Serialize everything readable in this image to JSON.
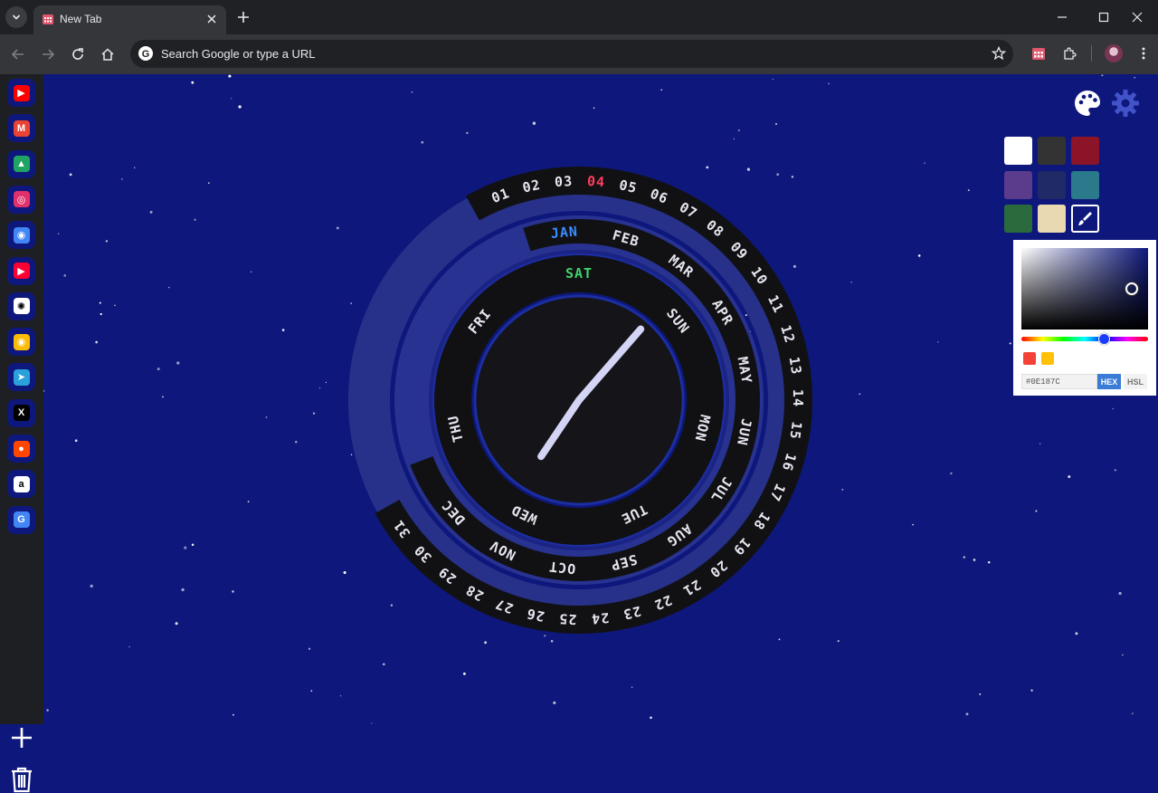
{
  "browser": {
    "tab_title": "New Tab",
    "omnibox_placeholder": "Search Google or type a URL"
  },
  "sidebar": {
    "items": [
      {
        "name": "youtube",
        "color": "#ff0000",
        "glyph": "▶"
      },
      {
        "name": "gmail",
        "color": "#ea4335",
        "glyph": "M"
      },
      {
        "name": "google-drive",
        "color": "#1fa463",
        "glyph": "▲"
      },
      {
        "name": "instagram",
        "color": "#e1306c",
        "glyph": "◎"
      },
      {
        "name": "chromium",
        "color": "#4285f4",
        "glyph": "◉"
      },
      {
        "name": "youtube-music",
        "color": "#ff0033",
        "glyph": "▶"
      },
      {
        "name": "chatgpt",
        "color": "#ffffff",
        "glyph": "✺"
      },
      {
        "name": "chrome",
        "color": "#fbbc05",
        "glyph": "◉"
      },
      {
        "name": "telegram",
        "color": "#2aa1da",
        "glyph": "➤"
      },
      {
        "name": "x",
        "color": "#000000",
        "glyph": "X"
      },
      {
        "name": "reddit",
        "color": "#ff4500",
        "glyph": "●"
      },
      {
        "name": "amazon",
        "color": "#ffffff",
        "glyph": "a"
      },
      {
        "name": "google-translate",
        "color": "#4285f4",
        "glyph": "G"
      }
    ]
  },
  "clock": {
    "days_of_month": [
      "01",
      "02",
      "03",
      "04",
      "05",
      "06",
      "07",
      "08",
      "09",
      "10",
      "11",
      "12",
      "13",
      "14",
      "15",
      "16",
      "17",
      "18",
      "19",
      "20",
      "21",
      "22",
      "23",
      "24",
      "25",
      "26",
      "27",
      "28",
      "29",
      "30",
      "31"
    ],
    "current_day": "04",
    "months": [
      "JAN",
      "FEB",
      "MAR",
      "APR",
      "MAY",
      "JUN",
      "JUL",
      "AUG",
      "SEP",
      "OCT",
      "NOV",
      "DEC"
    ],
    "current_month": "JAN",
    "weekdays": [
      "SAT",
      "SUN",
      "MON",
      "TUE",
      "WED",
      "THU",
      "FRI"
    ],
    "current_weekday": "SAT",
    "time": {
      "hour": 7,
      "minute": 7
    },
    "colors": {
      "day": "#ff3b5c",
      "month": "#3a8dff",
      "weekday": "#3fd26b",
      "text": "#e6e6f0",
      "ring": "#111114",
      "hand": "#d4d4f5"
    }
  },
  "theme": {
    "background": "#0e187c",
    "swatches": [
      "#ffffff",
      "#333333",
      "#8b1428",
      "#5b3b8c",
      "#1f2a66",
      "#2a7a8c",
      "#2a6a3d",
      "#e8d9b0",
      "#0e187c"
    ],
    "presets": [
      "#f44336",
      "#ffc107"
    ],
    "hex_value": "#0E187C",
    "modes": [
      "HEX",
      "HSL"
    ],
    "active_mode": "HEX"
  }
}
